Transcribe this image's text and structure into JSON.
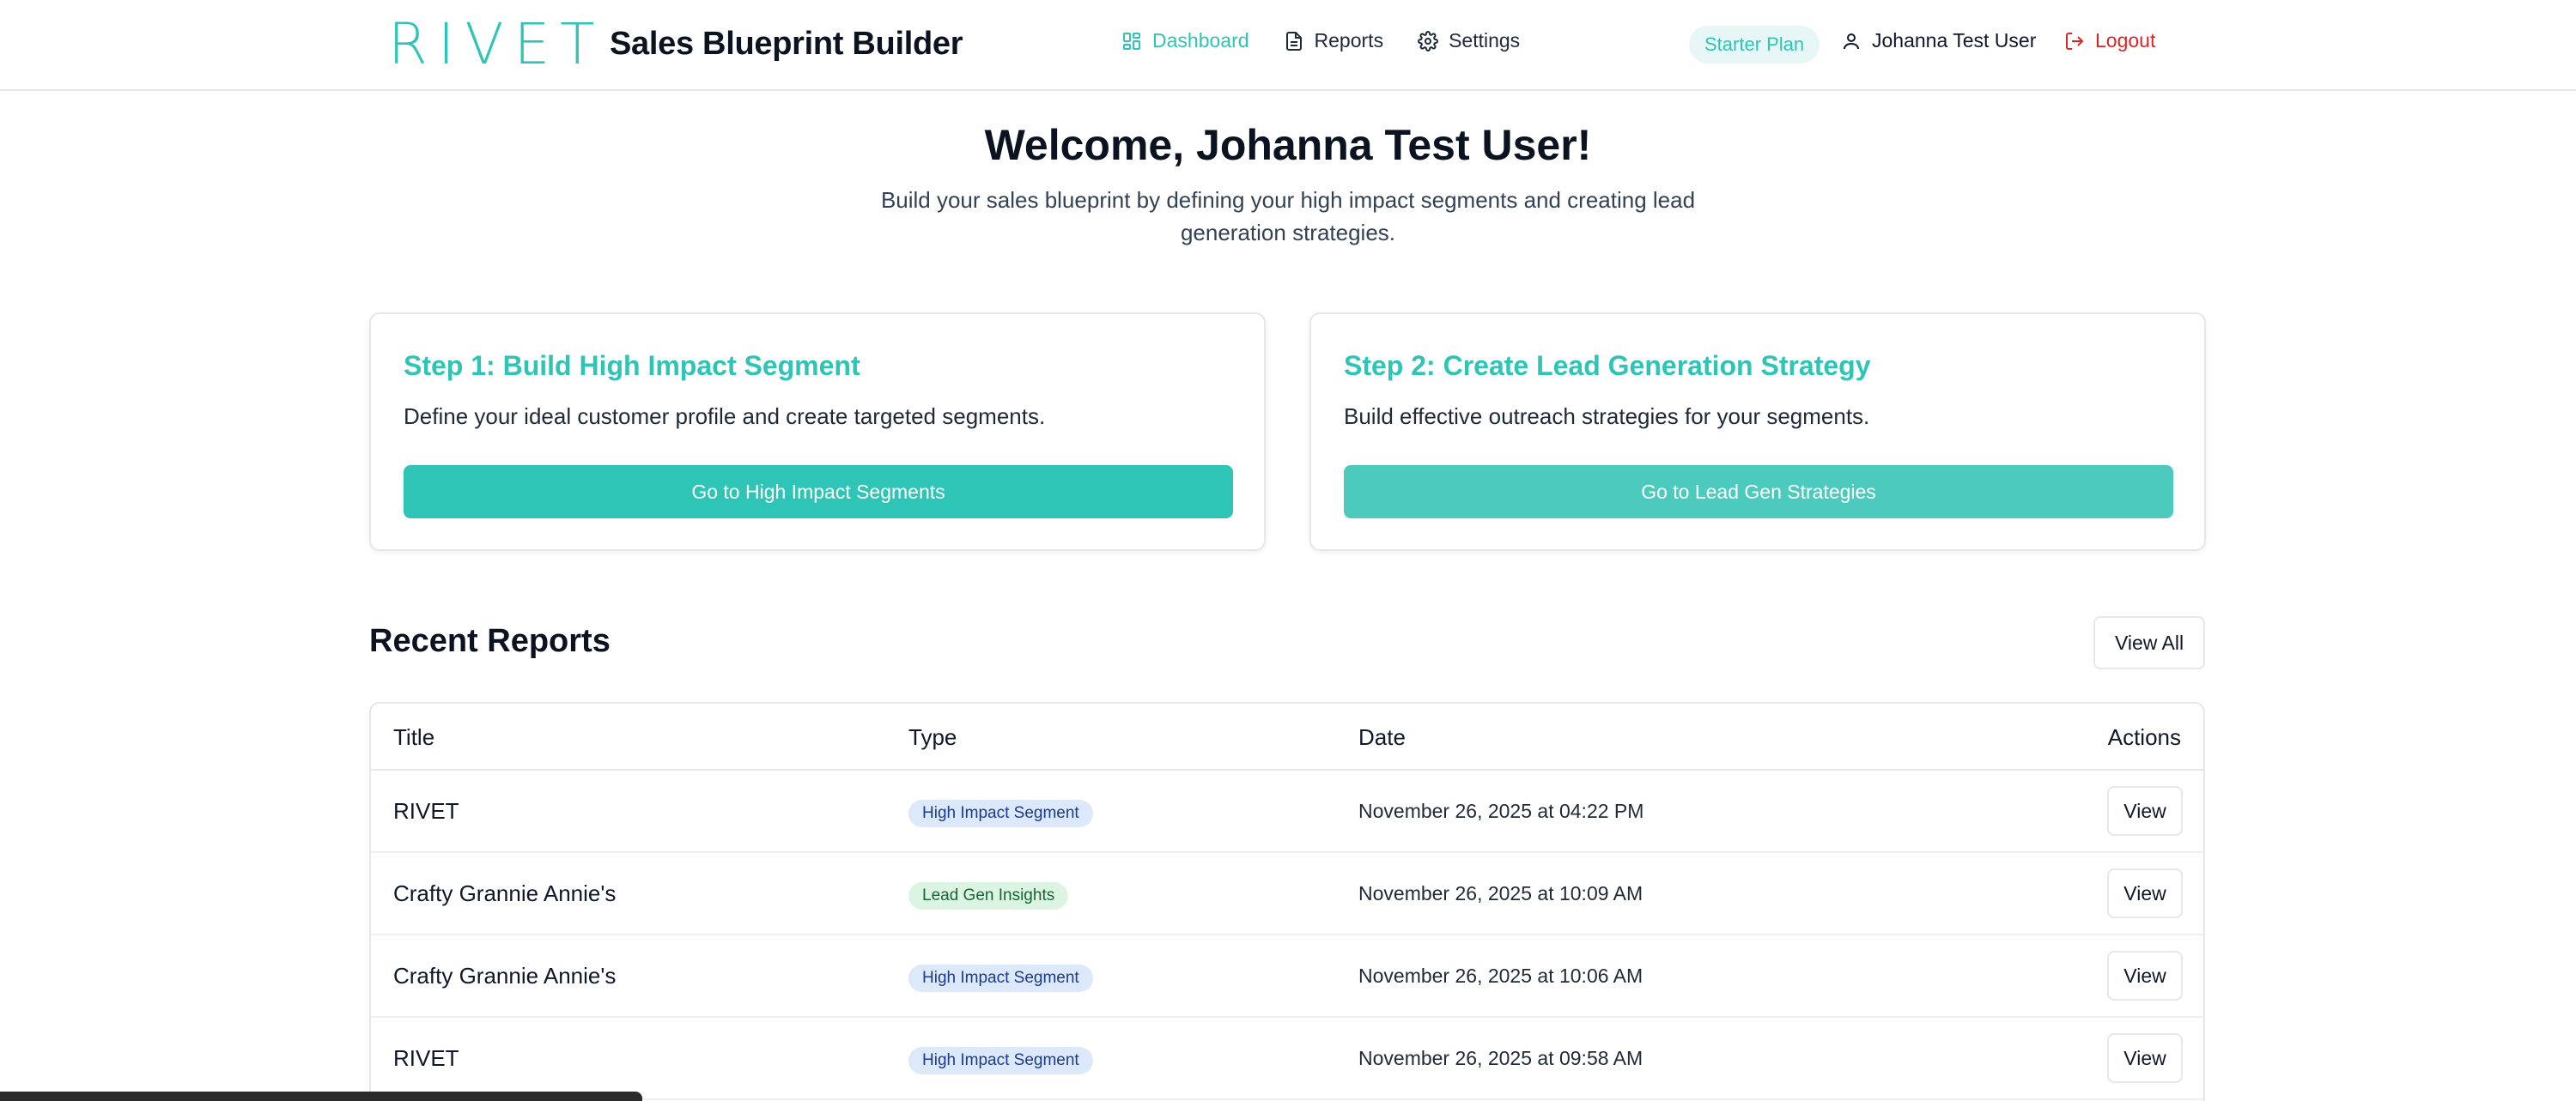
{
  "header": {
    "logo_text": "RIVET",
    "app_title": "Sales Blueprint Builder",
    "nav": [
      {
        "label": "Dashboard",
        "icon": "dashboard-grid-icon",
        "active": true
      },
      {
        "label": "Reports",
        "icon": "document-icon",
        "active": false
      },
      {
        "label": "Settings",
        "icon": "gear-icon",
        "active": false
      }
    ],
    "plan_badge": "Starter Plan",
    "user_name": "Johanna Test User",
    "logout_label": "Logout"
  },
  "welcome": {
    "title": "Welcome, Johanna Test User!",
    "subtitle": "Build your sales blueprint by defining your high impact segments and creating lead generation strategies."
  },
  "steps": [
    {
      "title": "Step 1: Build High Impact Segment",
      "description": "Define your ideal customer profile and create targeted segments.",
      "button_label": "Go to High Impact Segments"
    },
    {
      "title": "Step 2: Create Lead Generation Strategy",
      "description": "Build effective outreach strategies for your segments.",
      "button_label": "Go to Lead Gen Strategies"
    }
  ],
  "recent_reports": {
    "title": "Recent Reports",
    "view_all_label": "View All",
    "columns": {
      "title": "Title",
      "type": "Type",
      "date": "Date",
      "actions": "Actions"
    },
    "rows": [
      {
        "title": "RIVET",
        "type": "High Impact Segment",
        "type_kind": "segment",
        "date": "November 26, 2025 at 04:22 PM",
        "action": "View"
      },
      {
        "title": "Crafty Grannie Annie's",
        "type": "Lead Gen Insights",
        "type_kind": "leadgen",
        "date": "November 26, 2025 at 10:09 AM",
        "action": "View"
      },
      {
        "title": "Crafty Grannie Annie's",
        "type": "High Impact Segment",
        "type_kind": "segment",
        "date": "November 26, 2025 at 10:06 AM",
        "action": "View"
      },
      {
        "title": "RIVET",
        "type": "High Impact Segment",
        "type_kind": "segment",
        "date": "November 26, 2025 at 09:58 AM",
        "action": "View"
      }
    ]
  },
  "colors": {
    "brand": "#2ec4b6",
    "logout": "#dc2626",
    "segment_badge_bg": "#dbe9fb",
    "leadgen_badge_bg": "#dcf5e3"
  }
}
